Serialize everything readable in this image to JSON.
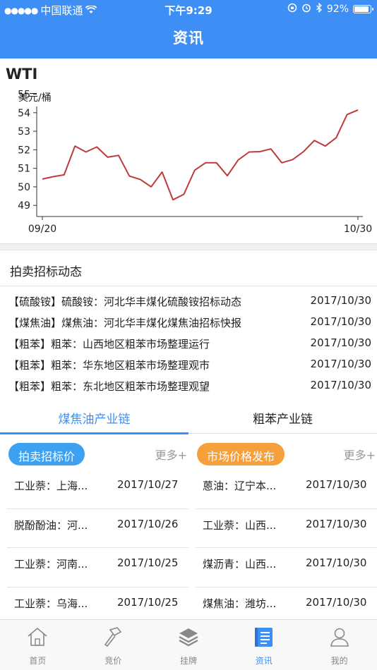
{
  "status": {
    "carrier": "中国联通",
    "time": "下午9:29",
    "battery": "92%"
  },
  "nav": {
    "title": "资讯"
  },
  "chart_data": {
    "type": "line",
    "title": "WTI",
    "ylabel": "美元/桶",
    "xlabel": "",
    "x_ticks": [
      "09/20",
      "10/30"
    ],
    "y_ticks": [
      49,
      50,
      51,
      52,
      53,
      54,
      55
    ],
    "ylim": [
      48.4,
      55.4
    ],
    "grid": false,
    "line_color": "#c0393b",
    "series": [
      {
        "values": [
          50.42,
          50.55,
          50.65,
          52.2,
          51.88,
          52.15,
          51.6,
          51.7,
          50.58,
          50.4,
          50.0,
          50.8,
          49.3,
          49.6,
          50.9,
          51.3,
          51.3,
          50.6,
          51.45,
          51.88,
          51.9,
          52.05,
          51.3,
          51.47,
          51.9,
          52.5,
          52.2,
          52.65,
          53.9,
          54.15
        ]
      }
    ]
  },
  "news": {
    "title": "拍卖招标动态",
    "items": [
      {
        "text": "【硫酸铵】硫酸铵：河北华丰煤化硫酸铵招标动态",
        "date": "2017/10/30"
      },
      {
        "text": "【煤焦油】煤焦油：河北华丰煤化煤焦油招标快报",
        "date": "2017/10/30"
      },
      {
        "text": "【粗苯】粗苯：山西地区粗苯市场整理运行",
        "date": "2017/10/30"
      },
      {
        "text": "【粗苯】粗苯：华东地区粗苯市场整理观市",
        "date": "2017/10/30"
      },
      {
        "text": "【粗苯】粗苯：东北地区粗苯市场整理观望",
        "date": "2017/10/30"
      }
    ]
  },
  "tabs": [
    {
      "label": "煤焦油产业链",
      "active": true
    },
    {
      "label": "粗苯产业链",
      "active": false
    }
  ],
  "left_panel": {
    "title": "拍卖招标价",
    "more": "更多+",
    "items": [
      {
        "name": "工业萘：上海...",
        "date": "2017/10/27"
      },
      {
        "name": "脱酚酚油：河...",
        "date": "2017/10/26"
      },
      {
        "name": "工业萘：河南...",
        "date": "2017/10/25"
      },
      {
        "name": "工业萘：乌海...",
        "date": "2017/10/25"
      }
    ]
  },
  "right_panel": {
    "title": "市场价格发布",
    "more": "更多+",
    "items": [
      {
        "name": "蒽油：辽宁本...",
        "date": "2017/10/30"
      },
      {
        "name": "工业萘：山西...",
        "date": "2017/10/30"
      },
      {
        "name": "煤沥青：山西...",
        "date": "2017/10/30"
      },
      {
        "name": "煤焦油：潍坊...",
        "date": "2017/10/30"
      }
    ]
  },
  "tabbar": [
    {
      "label": "首页",
      "icon": "home-icon"
    },
    {
      "label": "竞价",
      "icon": "hammer-icon"
    },
    {
      "label": "挂牌",
      "icon": "layers-icon"
    },
    {
      "label": "资讯",
      "icon": "news-icon",
      "active": true
    },
    {
      "label": "我的",
      "icon": "user-icon"
    }
  ],
  "colors": {
    "primary": "#3d8ff5",
    "pill_blue": "#3ea0f0",
    "pill_orange": "#f5a03a",
    "chart_line": "#c0393b"
  }
}
